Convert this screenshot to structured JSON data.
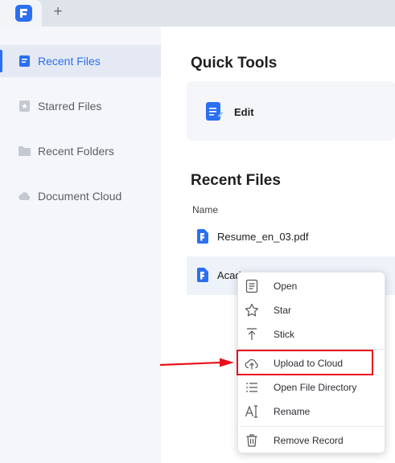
{
  "tabbar": {
    "add_tab_symbol": "+"
  },
  "sidebar": {
    "items": [
      {
        "label": "Recent Files",
        "icon": "document-icon",
        "active": true
      },
      {
        "label": "Starred Files",
        "icon": "star-file-icon",
        "active": false
      },
      {
        "label": "Recent Folders",
        "icon": "folder-icon",
        "active": false
      },
      {
        "label": "Document Cloud",
        "icon": "cloud-icon",
        "active": false
      }
    ]
  },
  "main": {
    "quick_tools_title": "Quick Tools",
    "quick_tools": [
      {
        "label": "Edit",
        "icon": "edit-document-icon"
      }
    ],
    "recent_files_title": "Recent Files",
    "column_name": "Name",
    "files": [
      {
        "name": "Resume_en_03.pdf"
      },
      {
        "name": "Acad"
      }
    ]
  },
  "context_menu": {
    "items": [
      {
        "label": "Open",
        "icon": "open-icon"
      },
      {
        "label": "Star",
        "icon": "star-icon"
      },
      {
        "label": "Stick",
        "icon": "pin-top-icon"
      },
      {
        "label": "Upload to Cloud",
        "icon": "cloud-upload-icon",
        "highlighted": true
      },
      {
        "label": "Open File Directory",
        "icon": "list-icon"
      },
      {
        "label": "Rename",
        "icon": "rename-icon"
      },
      {
        "label": "Remove Record",
        "icon": "trash-icon"
      }
    ]
  },
  "colors": {
    "accent": "#2b6ff2",
    "highlight": "#e8101a",
    "sidebar_bg": "#f4f6fa",
    "tabbar_bg": "#dfe3ea"
  }
}
